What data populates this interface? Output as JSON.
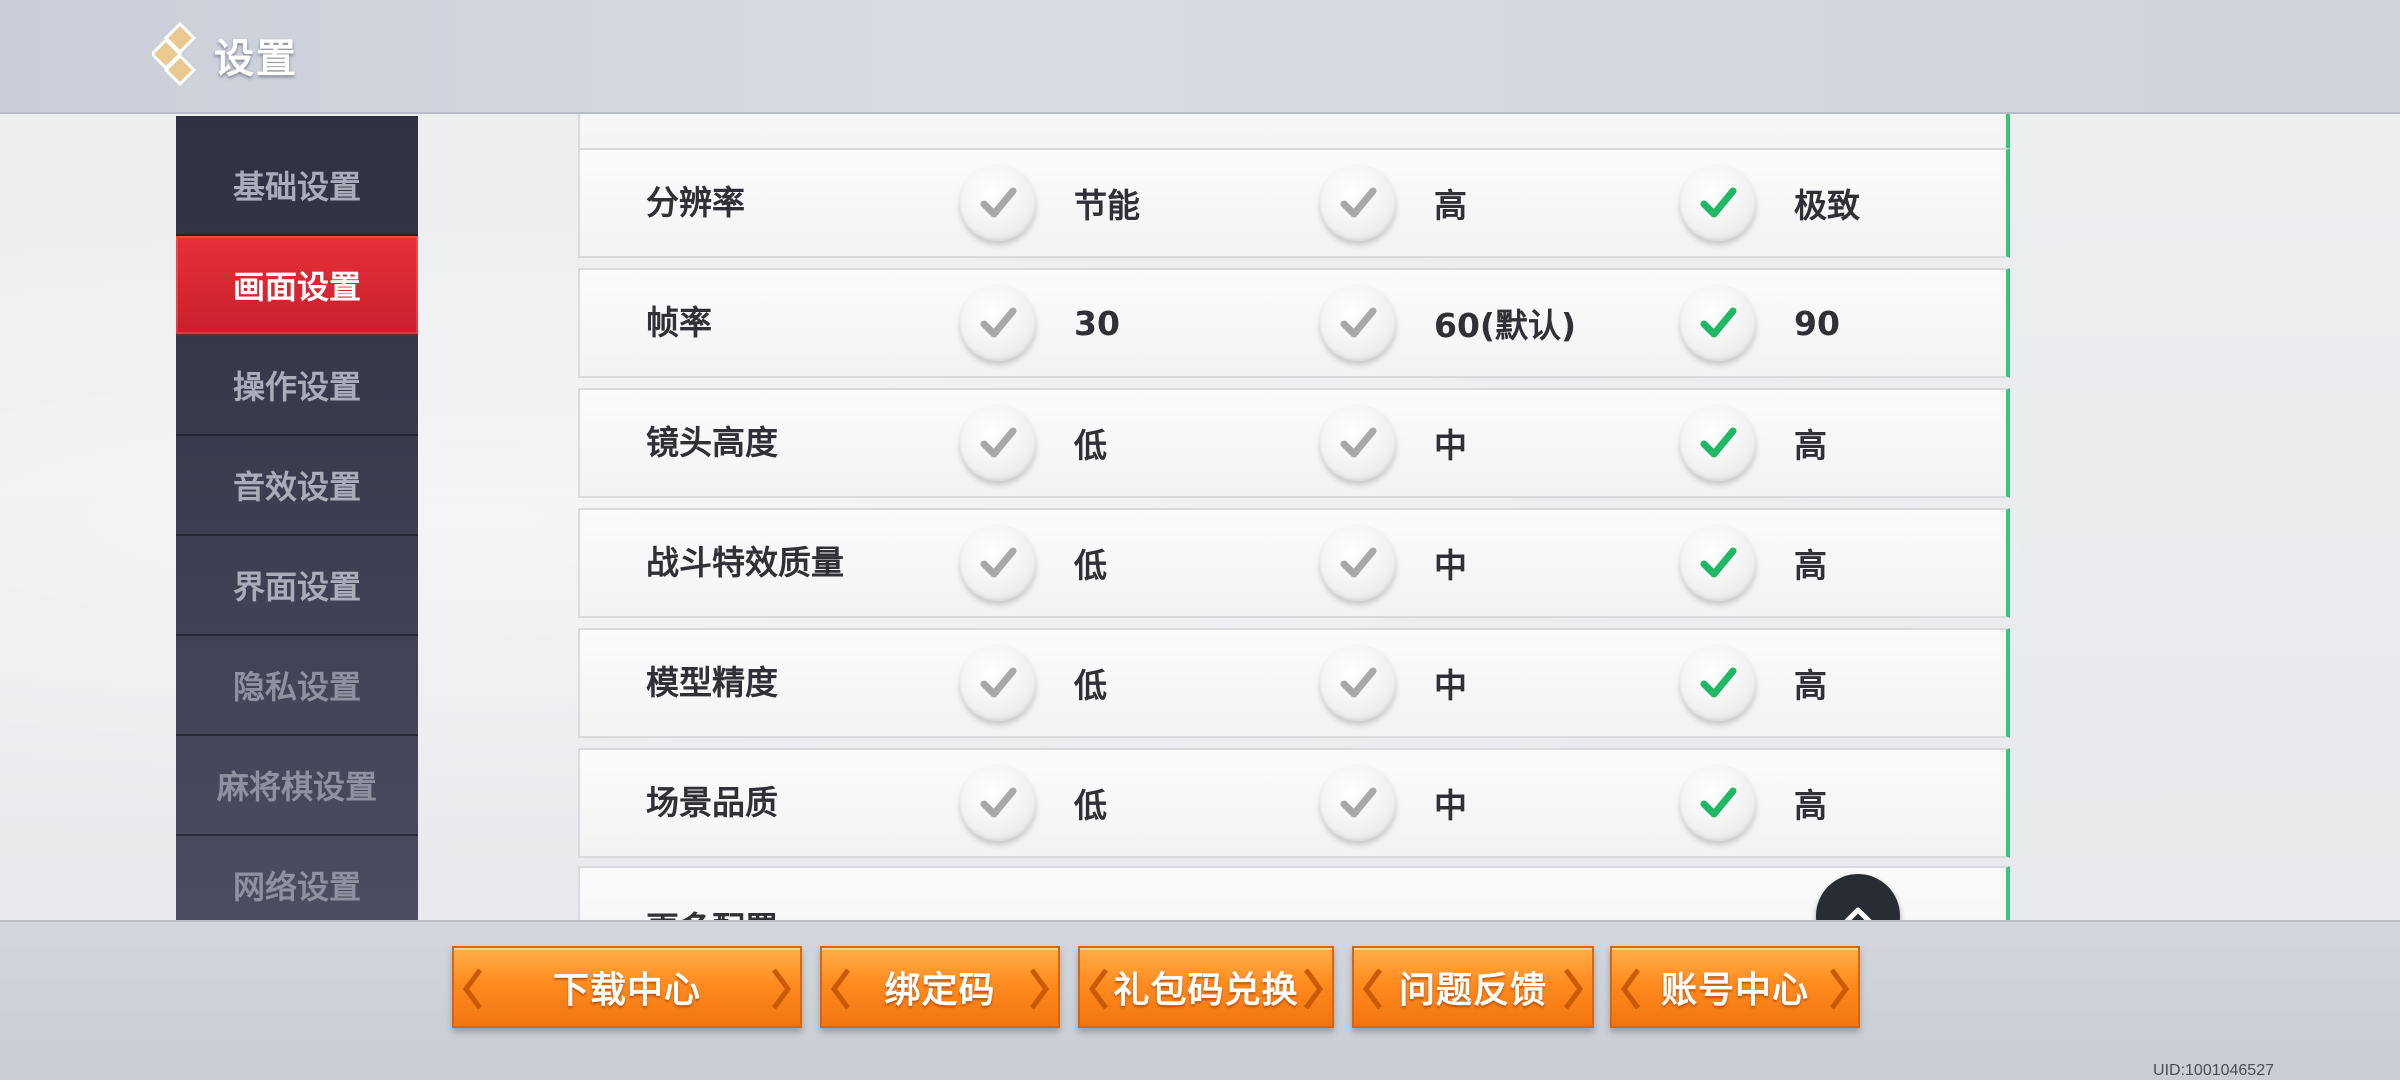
{
  "header": {
    "title": "设置",
    "logo_icon": "diamond-logo-icon"
  },
  "sidebar": {
    "items": [
      {
        "label": "基础设置",
        "active": false
      },
      {
        "label": "画面设置",
        "active": true
      },
      {
        "label": "操作设置",
        "active": false
      },
      {
        "label": "音效设置",
        "active": false
      },
      {
        "label": "界面设置",
        "active": false
      },
      {
        "label": "隐私设置",
        "active": false
      },
      {
        "label": "麻将棋设置",
        "active": false
      },
      {
        "label": "网络设置",
        "active": false
      }
    ]
  },
  "settings": {
    "rows": [
      {
        "label": "分辨率",
        "options": [
          "节能",
          "高",
          "极致"
        ],
        "selected": 2
      },
      {
        "label": "帧率",
        "options": [
          "30",
          "60(默认)",
          "90"
        ],
        "selected": 2
      },
      {
        "label": "镜头高度",
        "options": [
          "低",
          "中",
          "高"
        ],
        "selected": 2
      },
      {
        "label": "战斗特效质量",
        "options": [
          "低",
          "中",
          "高"
        ],
        "selected": 2
      },
      {
        "label": "模型精度",
        "options": [
          "低",
          "中",
          "高"
        ],
        "selected": 2
      },
      {
        "label": "场景品质",
        "options": [
          "低",
          "中",
          "高"
        ],
        "selected": 2
      }
    ],
    "partial_row_label": "更多配置",
    "scroll_top_icon": "chevron-up-icon"
  },
  "bottom_buttons": {
    "download": "下载中心",
    "bind_code": "绑定码",
    "gift_code": "礼包码兑换",
    "feedback": "问题反馈",
    "account": "账号中心"
  },
  "uid": "UID:1001046527",
  "colors": {
    "active_tab": "#d8262f",
    "check_selected": "#1fb865",
    "check_unselected": "#a8a8a8",
    "button_orange": "#ff8c1f",
    "row_accent": "#38c47a"
  }
}
